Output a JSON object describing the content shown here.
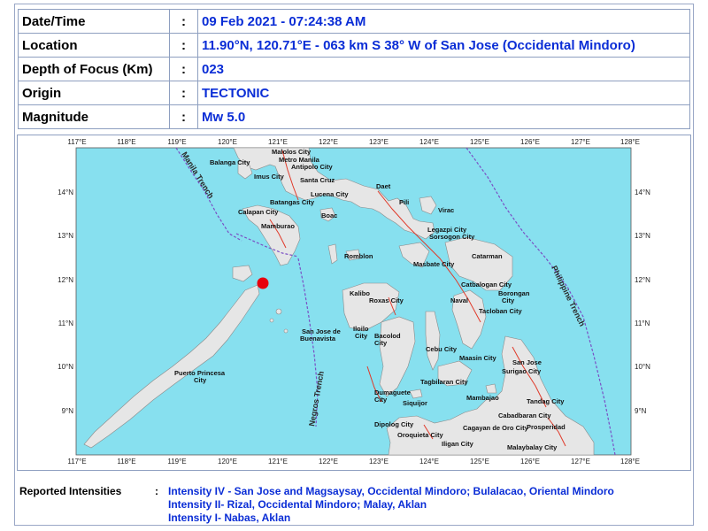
{
  "info": {
    "rows": [
      {
        "label": "Date/Time",
        "sep": ":",
        "value": "09 Feb 2021 - 07:24:38 AM"
      },
      {
        "label": "Location",
        "sep": ":",
        "value": "11.90°N, 120.71°E - 063 km S 38° W of San Jose (Occidental Mindoro)"
      },
      {
        "label": "Depth of Focus (Km)",
        "sep": ":",
        "value": "023"
      },
      {
        "label": "Origin",
        "sep": ":",
        "value": "TECTONIC"
      },
      {
        "label": "Magnitude",
        "sep": ":",
        "value": "Mw 5.0"
      }
    ]
  },
  "map": {
    "lon_ticks": [
      "117°E",
      "118°E",
      "119°E",
      "120°E",
      "121°E",
      "122°E",
      "123°E",
      "124°E",
      "125°E",
      "126°E",
      "127°E",
      "128°E"
    ],
    "lat_ticks": [
      "14°N",
      "13°N",
      "12°N",
      "11°N",
      "10°N",
      "9°N"
    ],
    "colors": {
      "sea": "#87e0ef",
      "land": "#e6e6e6",
      "fault": "#e03a2a",
      "trench": "#7a4fc4",
      "epicenter": "#e8000d"
    },
    "epicenter": {
      "lat": 11.9,
      "lon": 120.71,
      "icon": "epicenter-dot"
    },
    "trenches": {
      "manila": "Manila Trench",
      "negros": "Negros Trench",
      "philippine": "Philippine Trench"
    },
    "places": [
      {
        "name": "Malolos City"
      },
      {
        "name": "Metro Manila"
      },
      {
        "name": "Balanga City"
      },
      {
        "name": "Antipolo City"
      },
      {
        "name": "Imus City"
      },
      {
        "name": "Santa Cruz"
      },
      {
        "name": "Lucena City"
      },
      {
        "name": "Batangas City"
      },
      {
        "name": "Daet"
      },
      {
        "name": "Pili"
      },
      {
        "name": "Virac"
      },
      {
        "name": "Calapan City"
      },
      {
        "name": "Boac"
      },
      {
        "name": "Legazpi City"
      },
      {
        "name": "Mamburao"
      },
      {
        "name": "Sorsogon City"
      },
      {
        "name": "Catarman"
      },
      {
        "name": "Romblon"
      },
      {
        "name": "Masbate City"
      },
      {
        "name": "Catbalogan City"
      },
      {
        "name": "Borongan"
      },
      {
        "name": "City"
      },
      {
        "name": "Kalibo"
      },
      {
        "name": "Roxas City"
      },
      {
        "name": "Naval"
      },
      {
        "name": "Tacloban City"
      },
      {
        "name": "San Jose de"
      },
      {
        "name": "Buenavista"
      },
      {
        "name": "Iloilo"
      },
      {
        "name": "City"
      },
      {
        "name": "Bacolod"
      },
      {
        "name": "City"
      },
      {
        "name": "Cebu City"
      },
      {
        "name": "Maasin City"
      },
      {
        "name": "San Jose"
      },
      {
        "name": "Surigao City"
      },
      {
        "name": "Puerto Princesa"
      },
      {
        "name": "City"
      },
      {
        "name": "Tagbilaran City"
      },
      {
        "name": "Dumaguete"
      },
      {
        "name": "City"
      },
      {
        "name": "Siquijor"
      },
      {
        "name": "Mambajao"
      },
      {
        "name": "Tandag City"
      },
      {
        "name": "Cabadbaran City"
      },
      {
        "name": "Prosperidad"
      },
      {
        "name": "Dipolog City"
      },
      {
        "name": "Oroquieta City"
      },
      {
        "name": "Cagayan de Oro City"
      },
      {
        "name": "Iligan City"
      },
      {
        "name": "Malaybalay City"
      }
    ]
  },
  "intensities": {
    "label": "Reported Intensities",
    "sep": ":",
    "items": [
      "Intensity IV - San Jose and Magsaysay, Occidental Mindoro; Bulalacao, Oriental Mindoro",
      "Intensity II- Rizal, Occidental Mindoro; Malay, Aklan",
      "Intensity I- Nabas, Aklan"
    ]
  }
}
